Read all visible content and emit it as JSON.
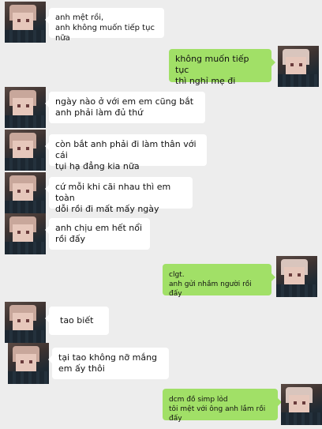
{
  "messages": [
    {
      "side": "left",
      "text": "anh mệt rồi,\nanh không muốn tiếp tục nữa"
    },
    {
      "side": "right",
      "text": "không muốn tiếp tục\nthì nghỉ mẹ đi"
    },
    {
      "side": "left",
      "text": "ngày nào ở với em em cũng bắt\nanh phải làm đủ thứ"
    },
    {
      "side": "left",
      "text": "còn bắt anh phải đi làm thân với cái\ntụi hạ đẳng kia nữa"
    },
    {
      "side": "left",
      "text": "cứ mỗi khi cãi nhau thì em toàn\ndỗi rồi đi mất mấy ngày"
    },
    {
      "side": "left",
      "text": "anh chịu em hết nổi\nrồi đấy"
    },
    {
      "side": "right",
      "text": "clgt.\nanh gửi nhầm người rồi đấy"
    },
    {
      "side": "left",
      "text": "tao biết"
    },
    {
      "side": "left",
      "text": "tại tao không nỡ mắng\nem ấy thôi"
    },
    {
      "side": "right",
      "text": "dcm đồ simp lỏd\ntôi mệt với ông anh lắm rồi đấy"
    }
  ]
}
